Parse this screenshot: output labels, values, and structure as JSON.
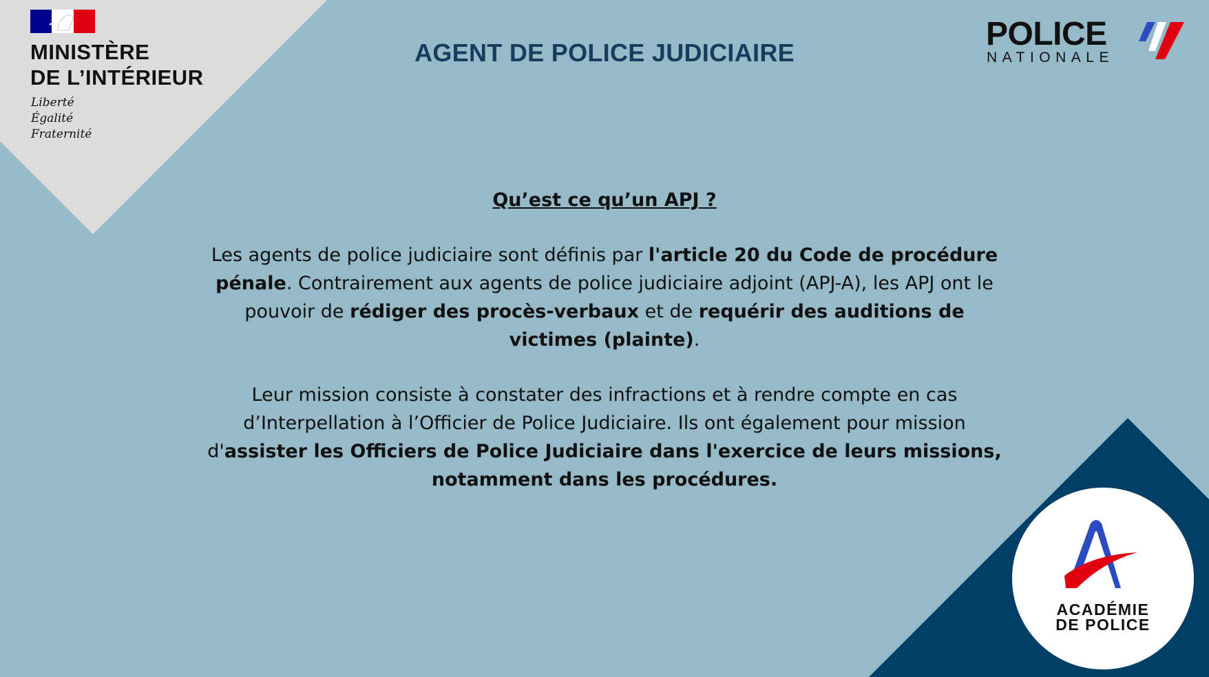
{
  "header": {
    "ministry": {
      "line1": "MINISTÈRE",
      "line2": "DE L’INTÉRIEUR",
      "motto": [
        "Liberté",
        "Égalité",
        "Fraternité"
      ],
      "logo_icon": "marianne-logo"
    },
    "title": "AGENT DE POLICE JUDICIAIRE",
    "police_logo": {
      "word": "POLICE",
      "subword": "NATIONALE",
      "icon": "tricolor-flag-stripes"
    }
  },
  "content": {
    "question": "Qu’est ce qu’un APJ ?",
    "paragraph1": [
      {
        "text": "Les agents de police judiciaire sont définis par ",
        "bold": false
      },
      {
        "text": "l'article 20 du Code de procédure pénale",
        "bold": true
      },
      {
        "text": ". Contrairement aux agents de police judiciaire adjoint (APJ-A), les APJ ont le pouvoir de ",
        "bold": false
      },
      {
        "text": "rédiger des procès-verbaux",
        "bold": true
      },
      {
        "text": " et de ",
        "bold": false
      },
      {
        "text": "requérir des auditions de victimes (plainte)",
        "bold": true
      },
      {
        "text": ".",
        "bold": false
      }
    ],
    "paragraph2": [
      {
        "text": "Leur mission consiste à constater des infractions et à rendre compte en cas d’Interpellation à l’Officier de Police Judiciaire. Ils ont également pour mission d'",
        "bold": false
      },
      {
        "text": "assister les Officiers de Police Judiciaire dans l'exercice de leurs missions, notamment dans les procédures.",
        "bold": true
      }
    ]
  },
  "academie": {
    "line1": "ACADÉMIE",
    "line2": "DE POLICE",
    "icon": "academie-a-logo"
  },
  "colors": {
    "background": "#97bac8",
    "corner_gray": "#dcdcdc",
    "corner_navy": "#023f66",
    "title": "#163d5e",
    "blue": "#2b4cc0",
    "red": "#e1000f"
  }
}
